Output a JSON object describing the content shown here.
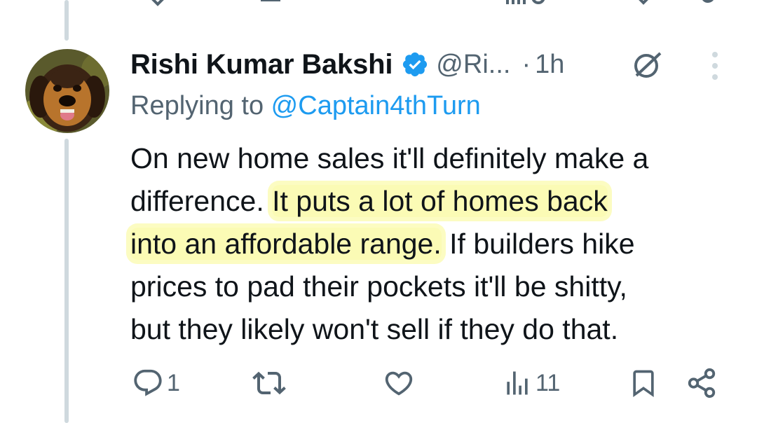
{
  "tweet": {
    "display_name": "Rishi Kumar Bakshi",
    "handle": "@Ri...",
    "separator": "·",
    "time": "1h",
    "replying_prefix": "Replying to ",
    "replying_to": "@Captain4thTurn",
    "body_lines": [
      {
        "pre": "On new home sales it'll definitely make a",
        "hl": "",
        "post": ""
      },
      {
        "pre": "difference. ",
        "hl": "It puts a lot of homes back",
        "post": ""
      },
      {
        "pre": "",
        "hl": "into an affordable range.",
        "post": " If builders hike"
      },
      {
        "pre": "prices to pad their pockets it'll be shitty,",
        "hl": "",
        "post": ""
      },
      {
        "pre": "but they likely won't sell if they do that.",
        "hl": "",
        "post": ""
      }
    ]
  },
  "actions": {
    "reply_count": "1",
    "retweet_count": "",
    "like_count": "",
    "views_count": "11"
  },
  "icons": {
    "verified": "verified-badge-icon",
    "grok": "grok-icon",
    "more": "more-vertical-icon",
    "reply": "reply-icon",
    "retweet": "retweet-icon",
    "like": "heart-icon",
    "views": "views-icon",
    "bookmark": "bookmark-icon",
    "share": "share-icon"
  },
  "colors": {
    "text": "#0f1419",
    "secondary": "#536471",
    "link": "#1d9bf0",
    "verified": "#1d9bf0",
    "highlight": "#f8f878"
  }
}
